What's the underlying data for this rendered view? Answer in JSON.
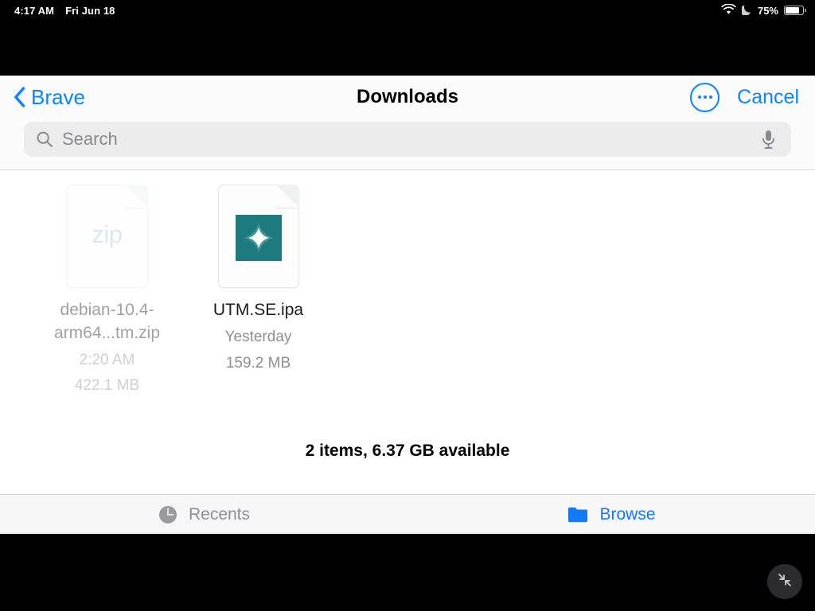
{
  "status_bar": {
    "time": "4:17 AM",
    "date": "Fri Jun 18",
    "wifi_icon": "wifi-icon",
    "dnd_icon": "crescent-moon-icon",
    "battery_percent": "75%",
    "battery_icon": "battery-icon"
  },
  "navbar": {
    "back_label": "Brave",
    "back_icon": "chevron-left-icon",
    "title": "Downloads",
    "more_icon": "ellipsis-circle-icon",
    "cancel_label": "Cancel"
  },
  "search": {
    "placeholder": "Search",
    "value": "",
    "search_icon": "search-icon",
    "mic_icon": "microphone-icon"
  },
  "files": [
    {
      "name": "debian-10.4-arm64...tm.zip",
      "date": "2:20 AM",
      "size": "422.1 MB",
      "icon_type": "zip-document-icon",
      "icon_text": "zip",
      "dimmed": true
    },
    {
      "name": "UTM.SE.ipa",
      "date": "Yesterday",
      "size": "159.2 MB",
      "icon_type": "ipa-document-icon",
      "icon_text": "",
      "dimmed": false
    }
  ],
  "summary": "2 items, 6.37 GB available",
  "tabs": [
    {
      "label": "Recents",
      "icon": "clock-icon",
      "active": false
    },
    {
      "label": "Browse",
      "icon": "folder-icon",
      "active": true
    }
  ],
  "floating_button": {
    "icon": "shrink-arrows-icon"
  },
  "colors": {
    "ios_blue": "#0a84ff",
    "tab_blue": "#1479f5",
    "utm_teal": "#1d7a7e",
    "zip_text": "#a9c9ec",
    "secondary_text": "#8e8e93"
  }
}
